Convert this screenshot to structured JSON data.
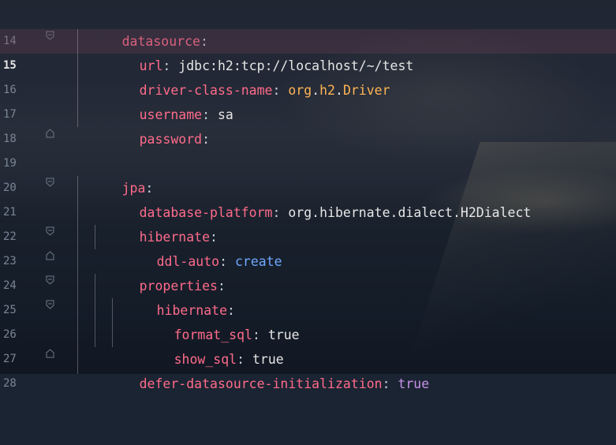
{
  "editor": {
    "highlighted_line": "15",
    "lines": [
      {
        "num": "14",
        "key": "datasource",
        "colon": ":",
        "value": ""
      },
      {
        "num": "15",
        "key": "url",
        "colon": ":",
        "value": " jdbc:h2:tcp://localhost/~/test"
      },
      {
        "num": "16",
        "key": "driver-class-name",
        "colon": ":",
        "value_parts": [
          "org",
          ".",
          "h2",
          ".",
          "Driver"
        ]
      },
      {
        "num": "17",
        "key": "username",
        "colon": ":",
        "value": " sa"
      },
      {
        "num": "18",
        "key": "password",
        "colon": ":",
        "value": ""
      },
      {
        "num": "19",
        "key": "",
        "colon": "",
        "value": ""
      },
      {
        "num": "20",
        "key": "jpa",
        "colon": ":",
        "value": ""
      },
      {
        "num": "21",
        "key": "database-platform",
        "colon": ":",
        "value": " org.hibernate.dialect.H2Dialect"
      },
      {
        "num": "22",
        "key": "hibernate",
        "colon": ":",
        "value": ""
      },
      {
        "num": "23",
        "key": "ddl-auto",
        "colon": ":",
        "value": " create"
      },
      {
        "num": "24",
        "key": "properties",
        "colon": ":",
        "value": ""
      },
      {
        "num": "25",
        "key": "hibernate",
        "colon": ":",
        "value": ""
      },
      {
        "num": "26",
        "key": "format_sql",
        "colon": ":",
        "value": " true"
      },
      {
        "num": "27",
        "key": "show_sql",
        "colon": ":",
        "value": " true"
      },
      {
        "num": "28",
        "key": "defer-datasource-initialization",
        "colon": ":",
        "value": " true"
      }
    ]
  },
  "icons": {
    "fold_marker": "fold-marker-icon"
  },
  "colors": {
    "key": "#ff6b8a",
    "value": "#e6e6e6",
    "class_name": "#ffb454",
    "keyword_create": "#6fa8ff",
    "keyword_true_purple": "#c792ea",
    "highlight_line_bg": "#5a3a4a"
  }
}
